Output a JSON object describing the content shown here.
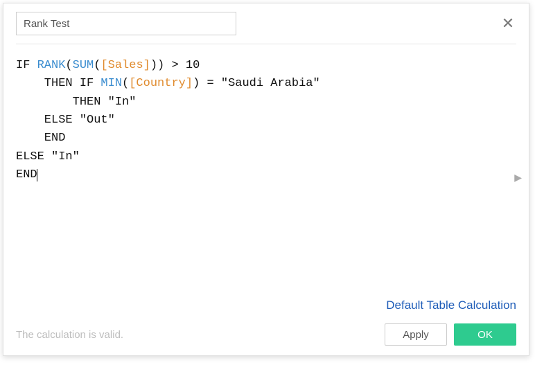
{
  "dialog": {
    "name_field_value": "Rank Test",
    "close_label": "✕",
    "expand_label": "▶",
    "link_label": "Default Table Calculation",
    "status_text": "The calculation is valid.",
    "apply_label": "Apply",
    "ok_label": "OK"
  },
  "colors": {
    "function": "#3a8ccf",
    "field": "#e08b2e",
    "text": "#111111",
    "accent": "#2ecb8f",
    "link": "#1f5db8"
  },
  "formula": {
    "lines": [
      [
        {
          "t": "IF ",
          "c": "text"
        },
        {
          "t": "RANK",
          "c": "function"
        },
        {
          "t": "(",
          "c": "text"
        },
        {
          "t": "SUM",
          "c": "function"
        },
        {
          "t": "(",
          "c": "text"
        },
        {
          "t": "[Sales]",
          "c": "field"
        },
        {
          "t": ")) > 10",
          "c": "text"
        }
      ],
      [
        {
          "t": "    THEN IF ",
          "c": "text"
        },
        {
          "t": "MIN",
          "c": "function"
        },
        {
          "t": "(",
          "c": "text"
        },
        {
          "t": "[Country]",
          "c": "field"
        },
        {
          "t": ") = \"Saudi Arabia\"",
          "c": "text"
        }
      ],
      [
        {
          "t": "        THEN \"In\"",
          "c": "text"
        }
      ],
      [
        {
          "t": "    ELSE \"Out\"",
          "c": "text"
        }
      ],
      [
        {
          "t": "    END",
          "c": "text"
        }
      ],
      [
        {
          "t": "ELSE \"In\"",
          "c": "text"
        }
      ],
      [
        {
          "t": "END",
          "c": "text",
          "caret": true
        }
      ]
    ]
  }
}
